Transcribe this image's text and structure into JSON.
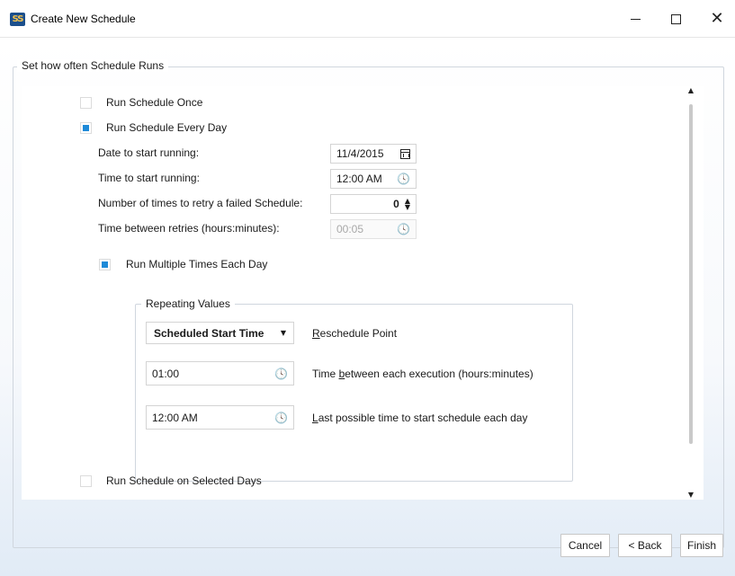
{
  "window": {
    "title": "Create New Schedule",
    "app_icon_text": "SS",
    "minimize_icon": "minimize-icon",
    "maximize_icon": "maximize-icon",
    "close_icon": "close-icon",
    "close_glyph": "✕"
  },
  "group": {
    "legend": "Set how often Schedule Runs"
  },
  "options": {
    "run_once": {
      "label": "Run Schedule Once",
      "checked": false
    },
    "run_every_day": {
      "label": "Run Schedule Every Day",
      "checked": true
    },
    "run_selected_days": {
      "label": "Run Schedule on Selected Days",
      "checked": false
    }
  },
  "fields": {
    "start_date": {
      "label": "Date to start running:",
      "value": "11/4/2015",
      "icon": "calendar-icon"
    },
    "start_time": {
      "label": "Time to start running:",
      "value": "12:00 AM",
      "icon": "clock-icon"
    },
    "retry_count": {
      "label": "Number of times to retry a failed Schedule:",
      "value": "0",
      "icon": "spinner-icon"
    },
    "retry_interval": {
      "label": "Time between retries (hours:minutes):",
      "value": "00:05",
      "icon": "clock-icon",
      "disabled": true
    }
  },
  "multi": {
    "label": "Run Multiple Times Each Day",
    "checked": true
  },
  "repeating": {
    "legend": "Repeating Values",
    "reschedule_point": {
      "selected": "Scheduled Start Time",
      "label_underlined": "R",
      "label_rest": "eschedule Point"
    },
    "interval": {
      "value": "01:00",
      "label_before": "Time ",
      "label_underlined": "b",
      "label_after": "etween each execution (hours:minutes)"
    },
    "last_time": {
      "value": "12:00 AM",
      "label_underlined": "L",
      "label_rest": "ast possible time to start schedule each day"
    }
  },
  "glyphs": {
    "clock": "🕓",
    "spin_up": "▲",
    "spin_down": "▼",
    "dropdown": "▼",
    "scroll_up": "▲",
    "scroll_down": "▼"
  },
  "buttons": {
    "cancel": "Cancel",
    "back": "< Back",
    "finish": "Finish"
  },
  "colors": {
    "accent_check": "#1e8ad8",
    "gradient_bottom": "#e1ebf6"
  }
}
